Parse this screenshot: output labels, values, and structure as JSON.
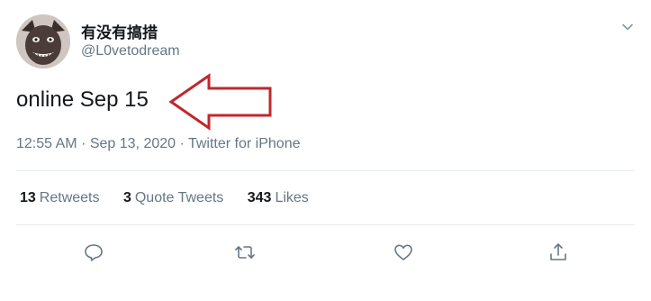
{
  "author": {
    "display_name": "有没有搞措",
    "handle": "@L0vetodream"
  },
  "tweet": {
    "text": "online Sep 15",
    "time": "12:55 AM",
    "date": "Sep 13, 2020",
    "source": "Twitter for iPhone",
    "separator": "·"
  },
  "stats": {
    "retweets_count": "13",
    "retweets_label": "Retweets",
    "quotes_count": "3",
    "quotes_label": "Quote Tweets",
    "likes_count": "343",
    "likes_label": "Likes"
  },
  "colors": {
    "annotation_arrow": "#c0272d",
    "secondary_text": "#657786",
    "icon": "#657786"
  },
  "icons": {
    "menu": "chevron-down-icon",
    "reply": "reply-icon",
    "retweet": "retweet-icon",
    "like": "heart-icon",
    "share": "share-icon"
  }
}
